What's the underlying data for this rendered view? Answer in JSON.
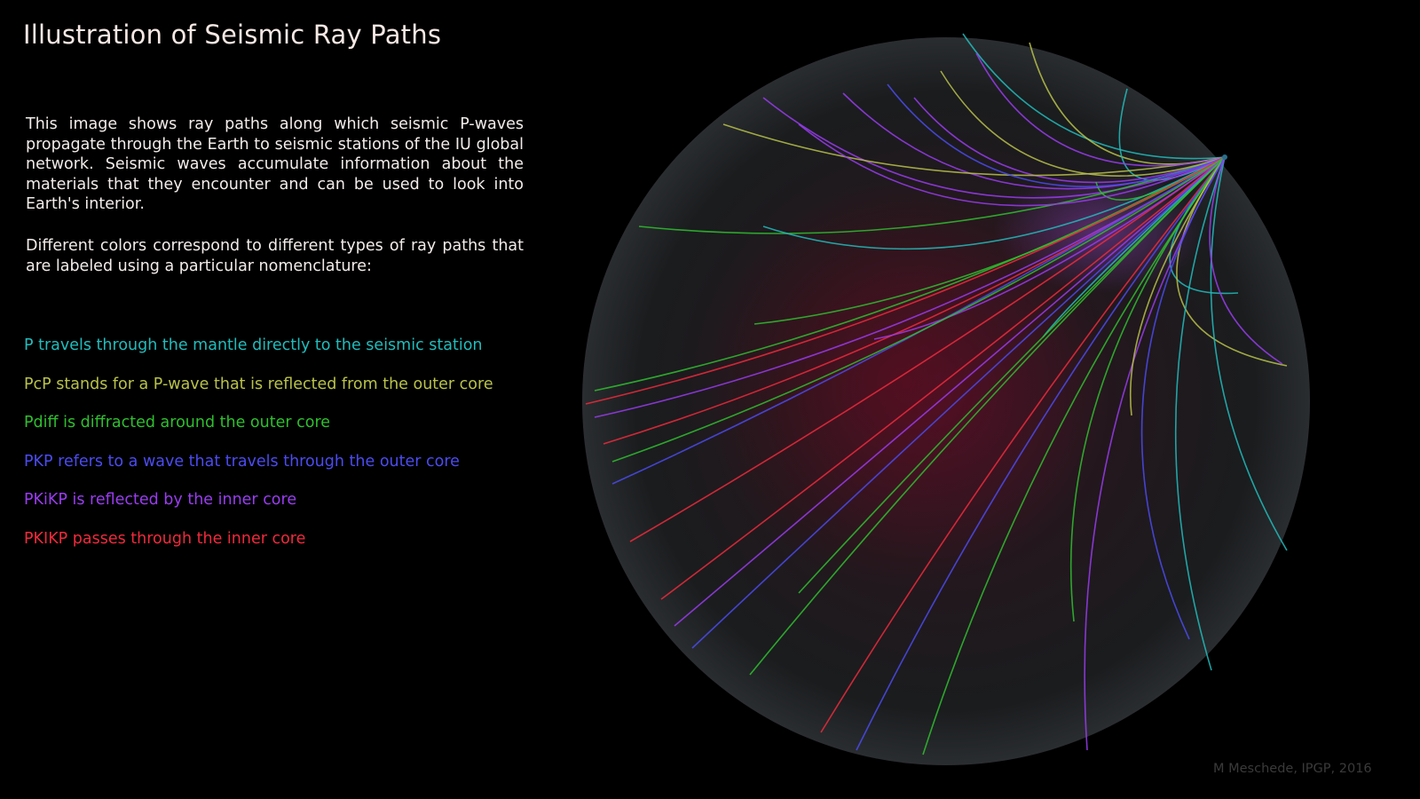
{
  "title": "Illustration of Seismic Ray Paths",
  "description": [
    "This image shows ray paths along which seismic P-waves propagate through the Earth to seismic stations of the IU global network. Seismic waves accumulate information about the materials that they encounter and can be used to look into Earth's interior.",
    "Different colors correspond to different types of ray paths that are labeled using a particular nomenclature:"
  ],
  "legend": [
    {
      "phase": "P",
      "text": "P travels through the mantle directly to the seismic station",
      "color": "#22bcbc"
    },
    {
      "phase": "PcP",
      "text": "PcP stands for a P-wave that is reflected from the outer core",
      "color": "#b9c24a"
    },
    {
      "phase": "Pdiff",
      "text": "Pdiff is diffracted around the outer core",
      "color": "#2fbf2f"
    },
    {
      "phase": "PKP",
      "text": "PKP refers to a wave that travels through the outer core",
      "color": "#4b4bf0"
    },
    {
      "phase": "PKiKP",
      "text": "PKiKP is reflected by the inner core",
      "color": "#9a3cf0"
    },
    {
      "phase": "PKIKP",
      "text": "PKIKP passes through the inner core",
      "color": "#f02a3c"
    }
  ],
  "credit": "M Meschede, IPGP, 2016"
}
